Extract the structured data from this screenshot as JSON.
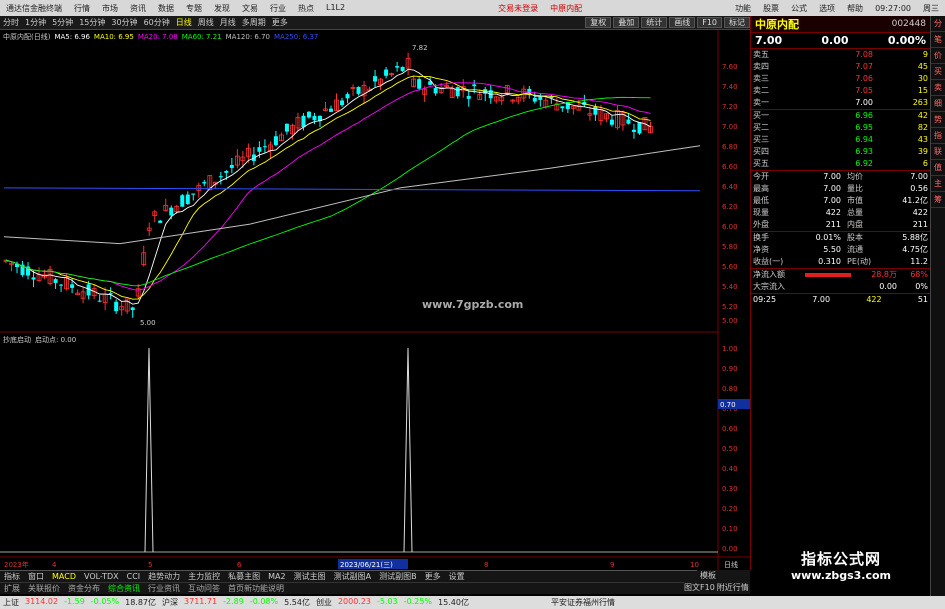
{
  "titlebar": {
    "app": "通达信金融终端",
    "menu": [
      "行情",
      "市场",
      "资讯",
      "数据",
      "专题",
      "发现",
      "文易",
      "行业",
      "热点",
      "L1L2"
    ],
    "center": [
      "交易未登录",
      "中原内配"
    ],
    "right": [
      "功能",
      "股票",
      "公式",
      "选项",
      "帮助"
    ],
    "time": "09:27:00",
    "weekday": "周三"
  },
  "periods": [
    "分时",
    "1分钟",
    "5分钟",
    "15分钟",
    "30分钟",
    "60分钟",
    "日线",
    "周线",
    "月线",
    "多周期",
    "更多"
  ],
  "active_period": "日线",
  "tool_buttons": [
    "复权",
    "叠加",
    "统计",
    "画线",
    "F10",
    "标记"
  ],
  "main_legend": {
    "name": "中原内配(日线)",
    "items": [
      {
        "label": "MA5: 6.96",
        "color": "#ffffff"
      },
      {
        "label": "MA10: 6.95",
        "color": "#ffff00"
      },
      {
        "label": "MA20: 7.08",
        "color": "#ff00ff"
      },
      {
        "label": "MA60: 7.21",
        "color": "#00ff00"
      },
      {
        "label": "MA120: 6.70",
        "color": "#c0c0c0"
      },
      {
        "label": "MA250: 6.37",
        "color": "#3050ff"
      }
    ]
  },
  "indicator_legend": {
    "name": "抄底启动",
    "label": "启动点: 0.00"
  },
  "price_axis": [
    "7.82",
    "7.60",
    "7.40",
    "7.20",
    "7.00",
    "6.80",
    "6.60",
    "6.40",
    "6.20",
    "6.00",
    "5.80",
    "5.60",
    "5.40",
    "5.20",
    "5.00"
  ],
  "ind_axis": [
    "1.00",
    "0.90",
    "0.80",
    "0.70",
    "0.60",
    "0.50",
    "0.40",
    "0.30",
    "0.20",
    "0.10",
    "0.00"
  ],
  "ind_marker": "0.70",
  "annotations": {
    "high": "7.82",
    "low": "5.00"
  },
  "watermark": "www.7gpzb.com",
  "date_bar": [
    "2023年",
    "4",
    "5",
    "6",
    "2023/06/21(三)",
    "8",
    "9",
    "10"
  ],
  "corner_btn": "日线",
  "stock": {
    "name": "中原内配",
    "code": "002448",
    "price": "7.00",
    "change": "0.00",
    "pct": "0.00%"
  },
  "orderbook": {
    "asks": [
      {
        "l": "卖五",
        "p": "7.08",
        "v": "9"
      },
      {
        "l": "卖四",
        "p": "7.07",
        "v": "45"
      },
      {
        "l": "卖三",
        "p": "7.06",
        "v": "30"
      },
      {
        "l": "卖二",
        "p": "7.05",
        "v": "15"
      },
      {
        "l": "卖一",
        "p": "7.00",
        "v": "263"
      }
    ],
    "bids": [
      {
        "l": "买一",
        "p": "6.96",
        "v": "42"
      },
      {
        "l": "买二",
        "p": "6.95",
        "v": "82"
      },
      {
        "l": "买三",
        "p": "6.94",
        "v": "43"
      },
      {
        "l": "买四",
        "p": "6.93",
        "v": "39"
      },
      {
        "l": "买五",
        "p": "6.92",
        "v": "6"
      }
    ]
  },
  "quote": [
    {
      "a": "今开",
      "b": "7.00",
      "c": "均价",
      "d": "7.00"
    },
    {
      "a": "最高",
      "b": "7.00",
      "c": "量比",
      "d": "0.56"
    },
    {
      "a": "最低",
      "b": "7.00",
      "c": "市值",
      "d": "41.2亿"
    },
    {
      "a": "现量",
      "b": "422",
      "c": "总量",
      "d": "422"
    },
    {
      "a": "外盘",
      "b": "211",
      "c": "内盘",
      "d": "211"
    }
  ],
  "stats": [
    {
      "a": "换手",
      "b": "0.01%",
      "c": "股本",
      "d": "5.88亿"
    },
    {
      "a": "净资",
      "b": "5.50",
      "c": "流通",
      "d": "4.75亿"
    },
    {
      "a": "收益(一)",
      "b": "0.310",
      "c": "PE(动)",
      "d": "11.2"
    }
  ],
  "flow": [
    {
      "a": "净流入额",
      "b": "28.8万",
      "c": "68%"
    },
    {
      "a": "大宗流入",
      "b": "0.00",
      "c": "0%"
    }
  ],
  "tick": {
    "time": "09:25",
    "price": "7.00",
    "vol": "422",
    "n": "51"
  },
  "sidebar": [
    "分",
    "笔",
    "价",
    "买",
    "卖",
    "细",
    "势",
    "指",
    "联",
    "值",
    "主",
    "筹"
  ],
  "bottom_tabs": [
    "指标",
    "窗口",
    "MACD",
    "VOL-TDX",
    "CCI",
    "趋势动力",
    "主力监控",
    "私募主图",
    "MA2",
    "测试主图",
    "测试副图A",
    "测试副图B",
    "更多",
    "设置"
  ],
  "sub_tabs": [
    "扩展",
    "关联报价",
    "资金分布",
    "综合资讯",
    "行业资讯",
    "互动问答",
    "首页新功能说明"
  ],
  "right_bottom": [
    "模板",
    "图文F10",
    "附近行情"
  ],
  "statusbar": {
    "items": [
      {
        "t": "上证",
        "c": ""
      },
      {
        "t": "3114.02",
        "c": "up"
      },
      {
        "t": "-1.59",
        "c": "dn"
      },
      {
        "t": "-0.05%",
        "c": "dn"
      },
      {
        "t": "18.87亿",
        "c": ""
      },
      {
        "t": "沪深",
        "c": ""
      },
      {
        "t": "3711.71",
        "c": "up"
      },
      {
        "t": "-2.89",
        "c": "dn"
      },
      {
        "t": "-0.08%",
        "c": "dn"
      },
      {
        "t": "5.54亿",
        "c": ""
      },
      {
        "t": "创业",
        "c": ""
      },
      {
        "t": "2000.23",
        "c": "up"
      },
      {
        "t": "-5.03",
        "c": "dn"
      },
      {
        "t": "-0.25%",
        "c": "dn"
      },
      {
        "t": "15.40亿",
        "c": ""
      }
    ],
    "broker": "平安证券福州行情"
  },
  "logo": {
    "cn": "指标公式网",
    "url": "www.zbgs3.com"
  }
}
